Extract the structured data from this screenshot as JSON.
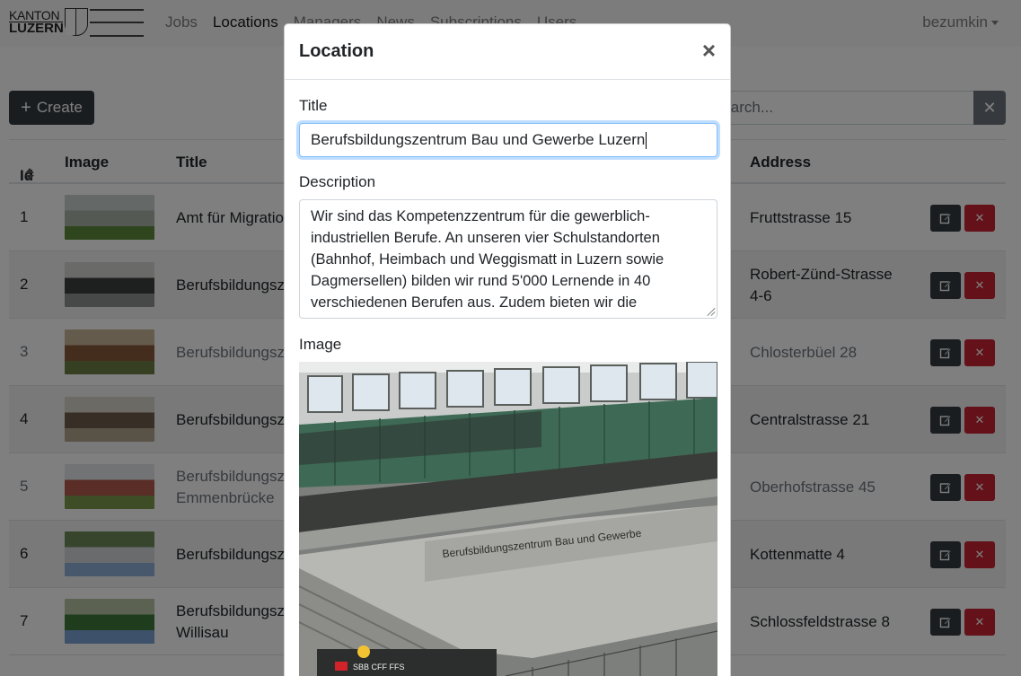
{
  "navbar": {
    "logo": {
      "line1": "KANTON",
      "line2": "LUZERN"
    },
    "links": [
      {
        "label": "Jobs",
        "active": false
      },
      {
        "label": "Locations",
        "active": true
      },
      {
        "label": "Managers",
        "active": false
      },
      {
        "label": "News",
        "active": false
      },
      {
        "label": "Subscriptions",
        "active": false
      },
      {
        "label": "Users",
        "active": false
      }
    ],
    "user": "bezumkin"
  },
  "toolbar": {
    "create_label": "Create",
    "search_placeholder": "Search..."
  },
  "table": {
    "headers": {
      "id": "Id",
      "image": "Image",
      "title": "Title",
      "address": "Address"
    },
    "rows": [
      {
        "id": "1",
        "title_lines": [
          "Amt für Migration"
        ],
        "address_lines": [
          "Fruttstrasse 15"
        ],
        "muted": false
      },
      {
        "id": "2",
        "title_lines": [
          "Berufsbildungszentrum Bau und Gewerbe Luzern"
        ],
        "address_lines": [
          "Robert-Zünd-Strasse",
          "4-6"
        ],
        "muted": false
      },
      {
        "id": "3",
        "title_lines": [
          "Berufsbildungszentrum"
        ],
        "address_lines": [
          "Chlosterbüel 28"
        ],
        "muted": true
      },
      {
        "id": "4",
        "title_lines": [
          "Berufsbildungszentrum"
        ],
        "address_lines": [
          "Centralstrasse 21"
        ],
        "muted": false
      },
      {
        "id": "5",
        "title_lines": [
          "Berufsbildungszentrum",
          "Emmenbrücke"
        ],
        "address_lines": [
          "Oberhofstrasse 45"
        ],
        "muted": true
      },
      {
        "id": "6",
        "title_lines": [
          "Berufsbildungszentrum"
        ],
        "address_lines": [
          "Kottenmatte 4"
        ],
        "muted": false
      },
      {
        "id": "7",
        "title_lines": [
          "Berufsbildungszentrum",
          "Willisau"
        ],
        "address_lines": [
          "Schlossfeldstrasse 8"
        ],
        "muted": false
      }
    ]
  },
  "modal": {
    "title": "Location",
    "title_label": "Title",
    "title_value": "Berufsbildungszentrum Bau und Gewerbe Luzern",
    "description_label": "Description",
    "description_value": "Wir sind das Kompetenzzentrum für die gewerblich-industriellen Berufe. An unseren vier Schulstandorten (Bahnhof, Heimbach und Weggismatt in Luzern sowie Dagmersellen) bilden wir rund 5'000 Lernende in 40 verschiedenen Berufen aus. Zudem bieten wir die",
    "image_label": "Image",
    "photo_sign": "Berufsbildungszentrum Bau und Gewerbe",
    "photo_sbb": "SBB CFF FFS"
  },
  "colors": {
    "primary_dark": "#343a40",
    "danger": "#c82333",
    "focus": "#80bdff"
  }
}
